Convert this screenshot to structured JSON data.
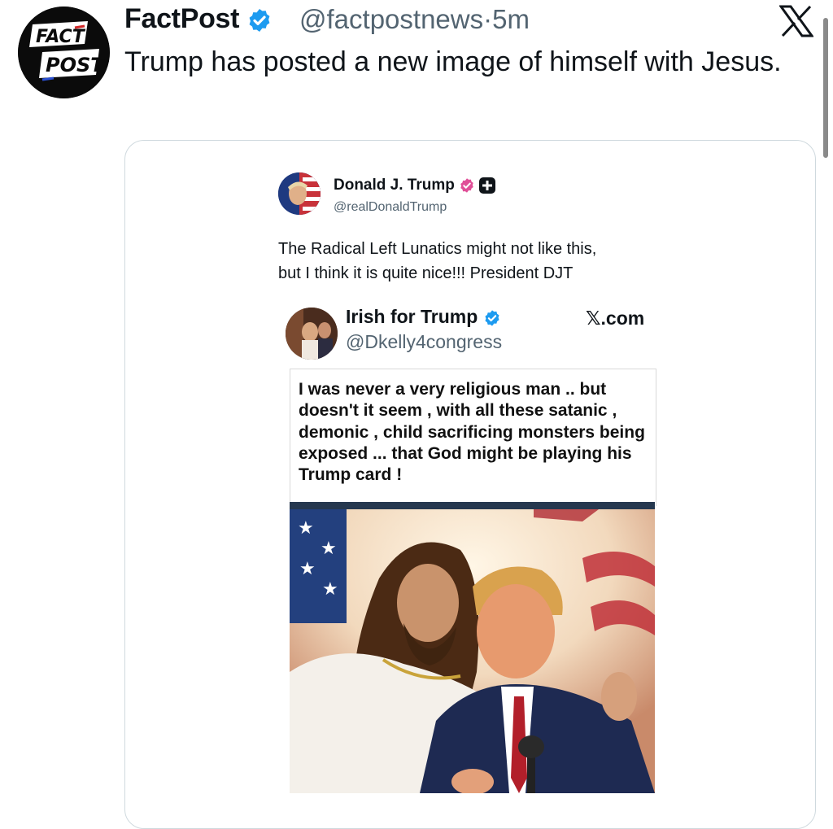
{
  "post": {
    "author_name": "FactPost",
    "author_handle": "@factpostnews",
    "separator": "·",
    "time": "5m",
    "text": "Trump has posted a new image of himself with Jesus.",
    "avatar_logo_top": "FACT",
    "avatar_logo_bottom": "POST",
    "platform_icon": "x-logo-icon",
    "colors": {
      "verified": "#1d9bf0",
      "text": "#0f1419",
      "muted": "#536471"
    }
  },
  "embedded": {
    "author_name": "Donald J. Trump",
    "author_handle": "@realDonaldTrump",
    "text_line1": "The Radical Left Lunatics might not like this,",
    "text_line2": "but I think it is quite nice!!! President DJT",
    "badge_color": "#e04f98"
  },
  "quoted": {
    "author_name": "Irish for Trump",
    "author_handle": "@Dkelly4congress",
    "source": "𝕏.com",
    "caption": "I was never a very religious man .. but doesn't it seem , with all these satanic , demonic , child sacrificing monsters being exposed ... that God might be playing his Trump card !",
    "image_alt": "image-of-trump-with-jesus"
  }
}
